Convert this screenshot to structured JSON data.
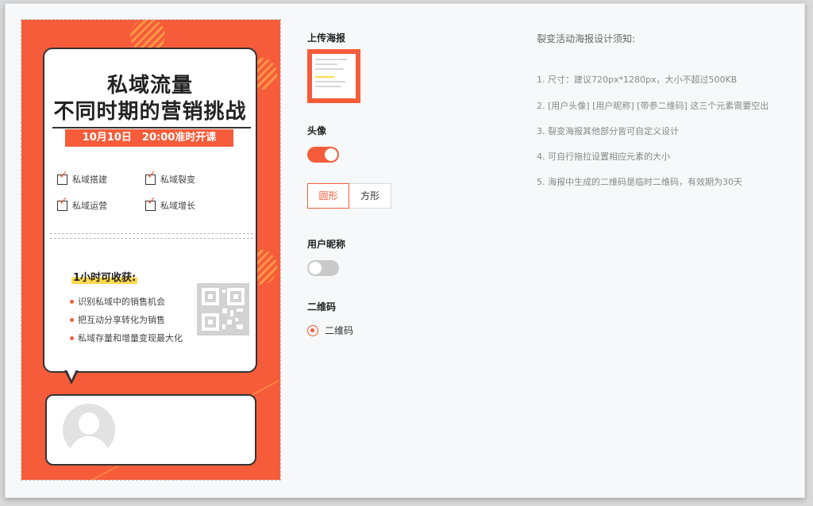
{
  "poster": {
    "title_line1": "私域流量",
    "title_line2": "不同时期的营销挑战",
    "date_bar": "10月10日　20:00准时开课",
    "features": [
      "私域搭建",
      "私域裂变",
      "私域运营",
      "私域增长"
    ],
    "gain_title": "1小时可收获:",
    "bullets": [
      "识别私域中的销售机会",
      "把互动分享转化为销售",
      "私域存量和增量变现最大化"
    ],
    "avatar_icon": "user-silhouette",
    "qr_icon": "qr-code",
    "accent_color": "#f65c3a"
  },
  "settings": {
    "upload_label": "上传海报",
    "avatar_label": "头像",
    "avatar_enabled": true,
    "shape_options": [
      "圆形",
      "方形"
    ],
    "shape_selected": "圆形",
    "nickname_label": "用户昵称",
    "nickname_enabled": false,
    "qr_label": "二维码",
    "qr_option": "二维码"
  },
  "notes": {
    "title": "裂变活动海报设计须知:",
    "items": [
      "1. 尺寸：建议720px*1280px，大小不超过500KB",
      "2. [用户头像] [用户昵称] [带参二维码] 这三个元素需要空出",
      "3. 裂变海报其他部分皆可自定义设计",
      "4. 可自行拖拉设置相应元素的大小",
      "5. 海报中生成的二维码是临时二维码，有效期为30天"
    ]
  }
}
